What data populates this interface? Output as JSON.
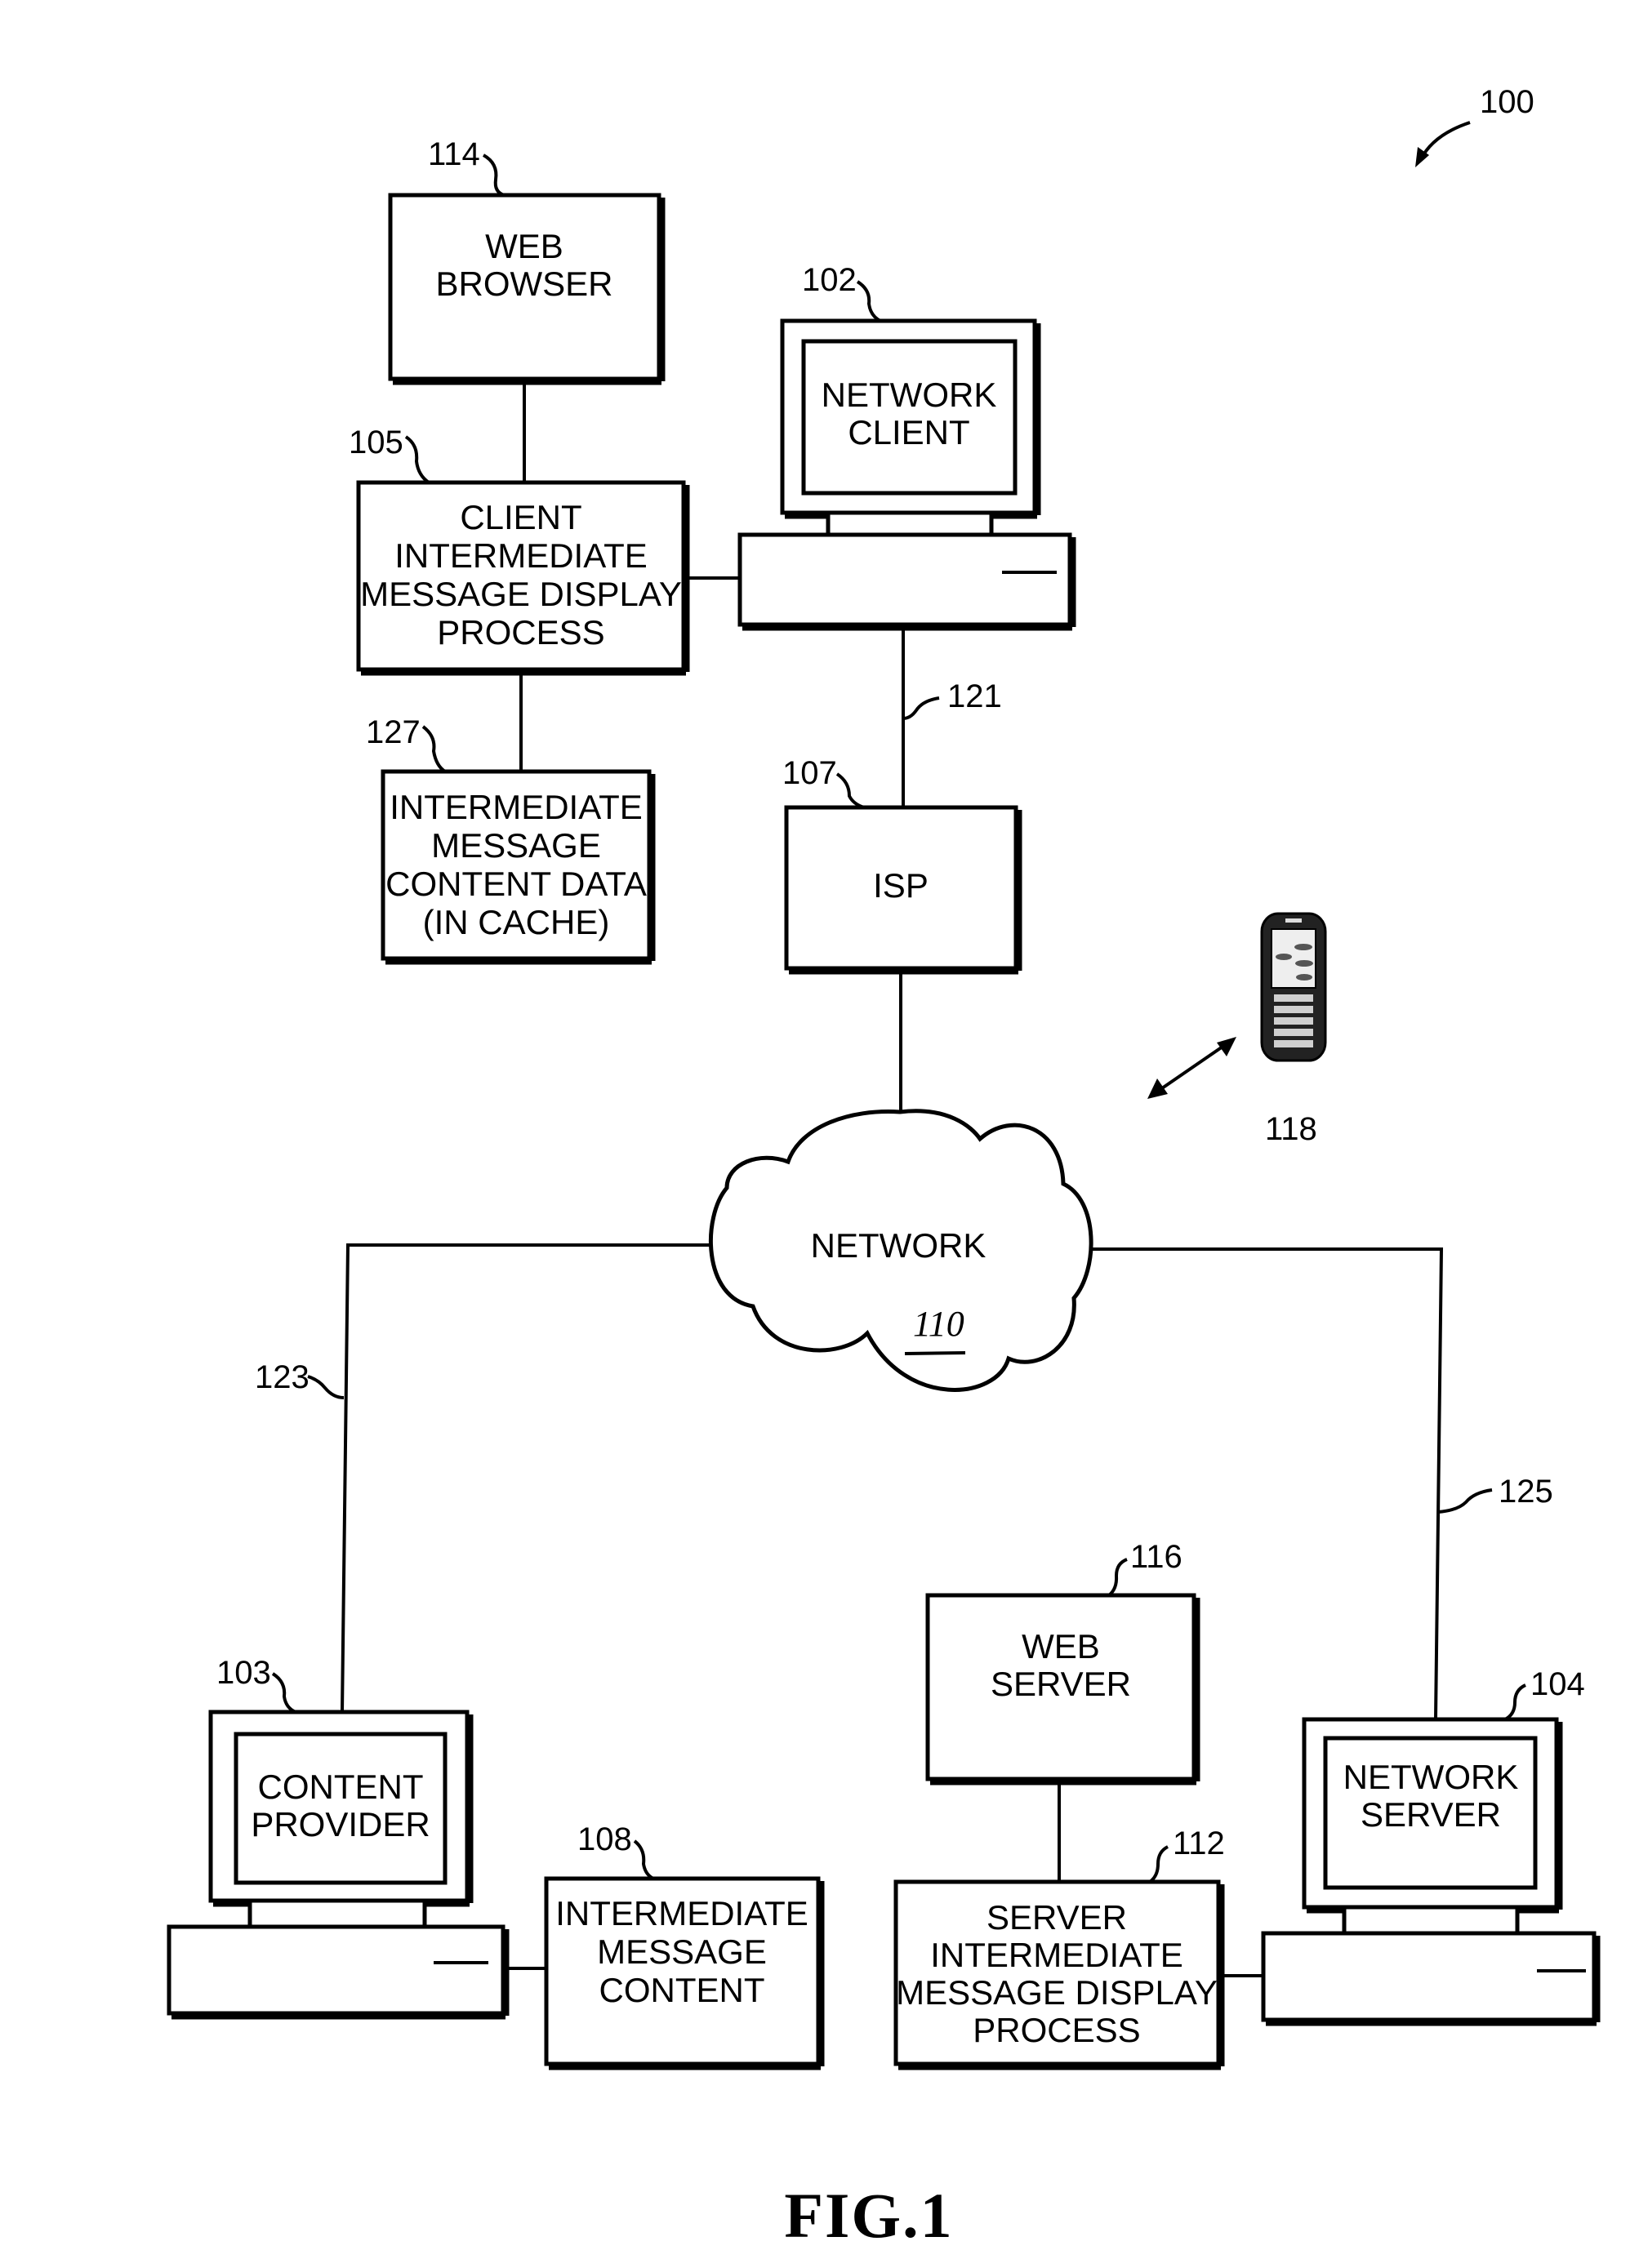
{
  "figure": {
    "caption": "FIG.1",
    "system_ref": "100"
  },
  "nodes": {
    "web_browser": {
      "ref": "114",
      "lines": [
        "WEB",
        "BROWSER"
      ]
    },
    "client_process": {
      "ref": "105",
      "lines": [
        "CLIENT",
        "INTERMEDIATE",
        "MESSAGE DISPLAY",
        "PROCESS"
      ]
    },
    "cache": {
      "ref": "127",
      "lines": [
        "INTERMEDIATE",
        "MESSAGE",
        "CONTENT DATA",
        "(IN CACHE)"
      ]
    },
    "network_client": {
      "ref": "102",
      "lines": [
        "NETWORK",
        "CLIENT"
      ]
    },
    "isp": {
      "ref": "107",
      "lines": [
        "ISP"
      ]
    },
    "mobile_device": {
      "ref": "118"
    },
    "network": {
      "ref": "110",
      "lines": [
        "NETWORK"
      ]
    },
    "content_provider": {
      "ref": "103",
      "lines": [
        "CONTENT",
        "PROVIDER"
      ]
    },
    "message_content": {
      "ref": "108",
      "lines": [
        "INTERMEDIATE",
        "MESSAGE",
        "CONTENT"
      ]
    },
    "web_server": {
      "ref": "116",
      "lines": [
        "WEB",
        "SERVER"
      ]
    },
    "server_process": {
      "ref": "112",
      "lines": [
        "SERVER",
        "INTERMEDIATE",
        "MESSAGE DISPLAY",
        "PROCESS"
      ]
    },
    "network_server": {
      "ref": "104",
      "lines": [
        "NETWORK",
        "SERVER"
      ]
    }
  },
  "links": {
    "client_to_isp": {
      "ref": "121"
    },
    "network_to_content_provider": {
      "ref": "123"
    },
    "network_to_network_server": {
      "ref": "125"
    }
  }
}
